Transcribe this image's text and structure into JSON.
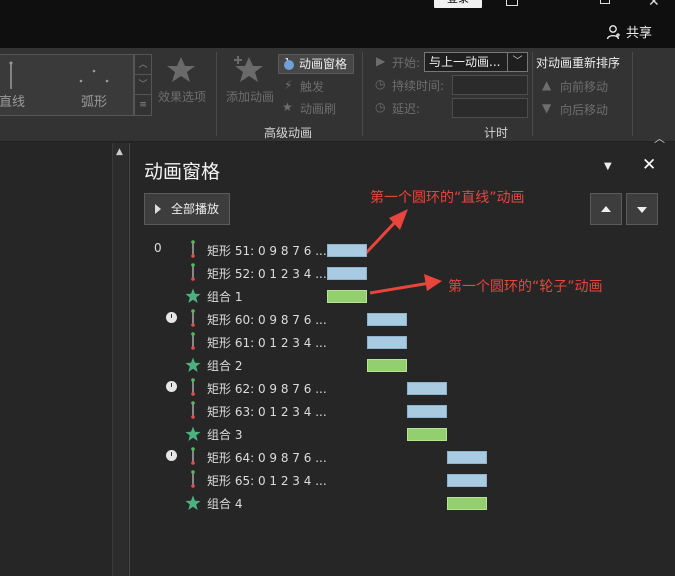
{
  "titlebar": {
    "login": "登录",
    "share": "共享"
  },
  "ribbon": {
    "gallery": {
      "item_line": "直线",
      "item_arc": "弧形"
    },
    "effect_options": "效果选项",
    "add_animation": "添加动画",
    "animation_pane": "动画窗格",
    "trigger": "触发",
    "animation_painter": "动画刷",
    "advanced_group": "高级动画",
    "start_label": "开始:",
    "start_value": "与上一动画...",
    "duration_label": "持续时间:",
    "delay_label": "延迟:",
    "timing_group": "计时",
    "reorder_title": "对动画重新排序",
    "move_earlier": "向前移动",
    "move_later": "向后移动"
  },
  "pane": {
    "title": "动画窗格",
    "play_all": "全部播放",
    "annotation_1": "第一个圆环的“直线”动画",
    "annotation_2": "第一个圆环的“轮子”动画",
    "items": [
      {
        "num": "0",
        "clock": false,
        "icon": "path",
        "label": "矩形 51: 0 9 8 7 6 ...",
        "bar": "blue",
        "slot": 0
      },
      {
        "num": "",
        "clock": false,
        "icon": "path",
        "label": "矩形 52: 0 1 2 3 4 ...",
        "bar": "blue",
        "slot": 0
      },
      {
        "num": "",
        "clock": false,
        "icon": "star",
        "label": "组合 1",
        "bar": "green",
        "slot": 0
      },
      {
        "num": "",
        "clock": true,
        "icon": "path",
        "label": "矩形 60: 0 9 8 7 6 ...",
        "bar": "blue",
        "slot": 1
      },
      {
        "num": "",
        "clock": false,
        "icon": "path",
        "label": "矩形 61: 0 1 2 3 4 ...",
        "bar": "blue",
        "slot": 1
      },
      {
        "num": "",
        "clock": false,
        "icon": "star",
        "label": "组合 2",
        "bar": "green",
        "slot": 1
      },
      {
        "num": "",
        "clock": true,
        "icon": "path",
        "label": "矩形 62: 0 9 8 7 6 ...",
        "bar": "blue",
        "slot": 2
      },
      {
        "num": "",
        "clock": false,
        "icon": "path",
        "label": "矩形 63: 0 1 2 3 4 ...",
        "bar": "blue",
        "slot": 2
      },
      {
        "num": "",
        "clock": false,
        "icon": "star",
        "label": "组合 3",
        "bar": "green",
        "slot": 2
      },
      {
        "num": "",
        "clock": true,
        "icon": "path",
        "label": "矩形 64: 0 9 8 7 6 ...",
        "bar": "blue",
        "slot": 3
      },
      {
        "num": "",
        "clock": false,
        "icon": "path",
        "label": "矩形 65: 0 1 2 3 4 ...",
        "bar": "blue",
        "slot": 3
      },
      {
        "num": "",
        "clock": false,
        "icon": "star",
        "label": "组合 4",
        "bar": "green",
        "slot": 3
      }
    ]
  },
  "colors": {
    "bar_blue": "#a9cbe2",
    "bar_green": "#93cf6f",
    "annotation": "#e8453c"
  }
}
